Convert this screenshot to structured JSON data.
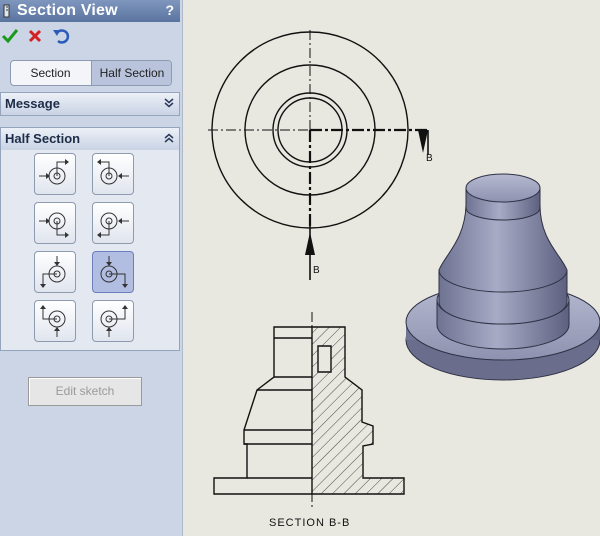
{
  "property_manager": {
    "title": "Section View",
    "help_glyph": "?",
    "toolbar": [
      {
        "name": "ok-icon",
        "color": "#1a9a1a"
      },
      {
        "name": "cancel-icon",
        "color": "#d42020"
      },
      {
        "name": "undo-icon",
        "color": "#2a5bb8"
      }
    ],
    "mode_tabs": [
      {
        "label": "Section",
        "selected": false
      },
      {
        "label": "Half Section",
        "selected": true
      }
    ],
    "groups": {
      "message": {
        "label": "Message",
        "expanded": false
      },
      "half_section": {
        "label": "Half Section",
        "expanded": true
      }
    },
    "half_section_options": {
      "count": 8,
      "selected_index": 3
    },
    "edit_sketch_label": "Edit sketch"
  },
  "drawing": {
    "section_arrow_label_top": "B",
    "section_arrow_label_bottom": "B",
    "section_caption": "SECTION B-B",
    "part_color": "#8e92b0"
  }
}
